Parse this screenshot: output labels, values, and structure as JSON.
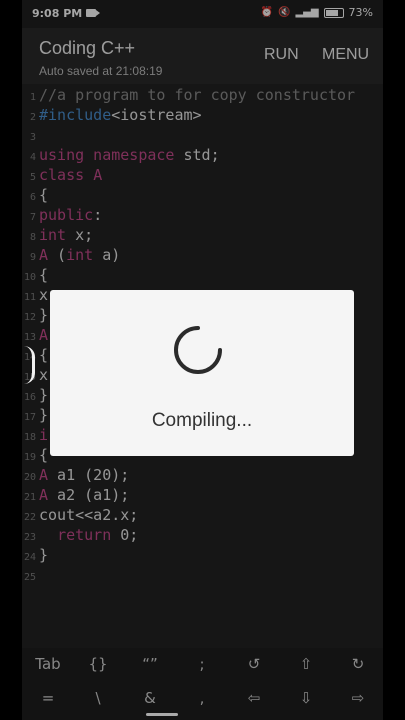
{
  "status": {
    "time": "9:08 PM",
    "battery": "73%"
  },
  "app": {
    "title": "Coding C++",
    "subtitle": "Auto saved at 21:08:19",
    "run": "RUN",
    "menu": "MENU"
  },
  "editor": {
    "lines": [
      {
        "n": "1",
        "t": "//a program to for copy constructor"
      },
      {
        "n": "2",
        "t": "#include<iostream>"
      },
      {
        "n": "3",
        "t": ""
      },
      {
        "n": "4",
        "t": "using namespace std;"
      },
      {
        "n": "5",
        "t": "class A"
      },
      {
        "n": "6",
        "t": "{"
      },
      {
        "n": "7",
        "t": "public:"
      },
      {
        "n": "8",
        "t": "int x;"
      },
      {
        "n": "9",
        "t": "A (int a)"
      },
      {
        "n": "10",
        "t": "{"
      },
      {
        "n": "11",
        "t": "x"
      },
      {
        "n": "12",
        "t": "}"
      },
      {
        "n": "13",
        "t": "A"
      },
      {
        "n": "14",
        "t": "{"
      },
      {
        "n": "15",
        "t": "x"
      },
      {
        "n": "16",
        "t": "}"
      },
      {
        "n": "17",
        "t": "}"
      },
      {
        "n": "18",
        "t": "i"
      },
      {
        "n": "19",
        "t": "{"
      },
      {
        "n": "20",
        "t": "A a1 (20);"
      },
      {
        "n": "21",
        "t": "A a2 (a1);"
      },
      {
        "n": "22",
        "t": "cout<<a2.x;"
      },
      {
        "n": "23",
        "t": "  return 0;"
      },
      {
        "n": "24",
        "t": "}"
      },
      {
        "n": "25",
        "t": ""
      }
    ]
  },
  "dialog": {
    "message": "Compiling..."
  },
  "keybar": {
    "row1": [
      "Tab",
      "{}",
      "“”",
      ";",
      "↺",
      "⇧",
      "↻"
    ],
    "row2": [
      "=",
      "\\",
      "&",
      ",",
      "⇦",
      "⇩",
      "⇨"
    ]
  }
}
